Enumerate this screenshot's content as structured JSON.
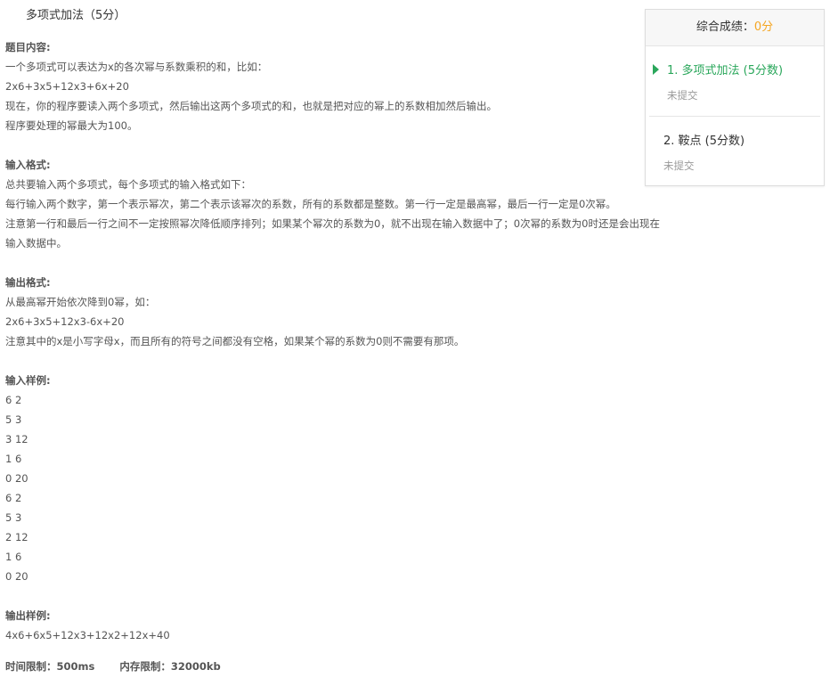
{
  "problem": {
    "title": "多项式加法（5分）",
    "content_heading": "题目内容:",
    "content_lines": [
      "一个多项式可以表达为x的各次幂与系数乘积的和，比如：",
      "2x6+3x5+12x3+6x+20",
      "现在，你的程序要读入两个多项式，然后输出这两个多项式的和，也就是把对应的幂上的系数相加然后输出。",
      "程序要处理的幂最大为100。"
    ],
    "input_heading": "输入格式:",
    "input_lines": [
      "总共要输入两个多项式，每个多项式的输入格式如下：",
      "每行输入两个数字，第一个表示幂次，第二个表示该幂次的系数，所有的系数都是整数。第一行一定是最高幂，最后一行一定是0次幂。",
      "注意第一行和最后一行之间不一定按照幂次降低顺序排列；如果某个幂次的系数为0，就不出现在输入数据中了；0次幂的系数为0时还是会出现在",
      "输入数据中。"
    ],
    "output_heading": "输出格式:",
    "output_lines": [
      "从最高幂开始依次降到0幂，如：",
      "2x6+3x5+12x3-6x+20",
      "注意其中的x是小写字母x，而且所有的符号之间都没有空格，如果某个幂的系数为0则不需要有那项。"
    ],
    "sample_input_heading": "输入样例:",
    "sample_input_lines": [
      "6 2",
      "5 3",
      "3 12",
      "1 6",
      "0 20",
      "6 2",
      "5 3",
      "2 12",
      "1 6",
      "0 20"
    ],
    "sample_output_heading": "输出样例:",
    "sample_output_lines": [
      "4x6+6x5+12x3+12x2+12x+40"
    ],
    "time_limit": "时间限制：500ms",
    "memory_limit": "内存限制：32000kb"
  },
  "score_panel": {
    "label": "综合成绩：",
    "value": "0分",
    "items": [
      {
        "title": "1. 多项式加法 (5分数)",
        "status": "未提交",
        "active": true
      },
      {
        "title": "2. 鞍点 (5分数)",
        "status": "未提交",
        "active": false
      }
    ]
  },
  "colors": {
    "accent_green": "#2aa75b",
    "score_orange": "#f5a623",
    "muted_text": "#999999"
  },
  "icons": {
    "active_marker": "caret-right-icon"
  }
}
